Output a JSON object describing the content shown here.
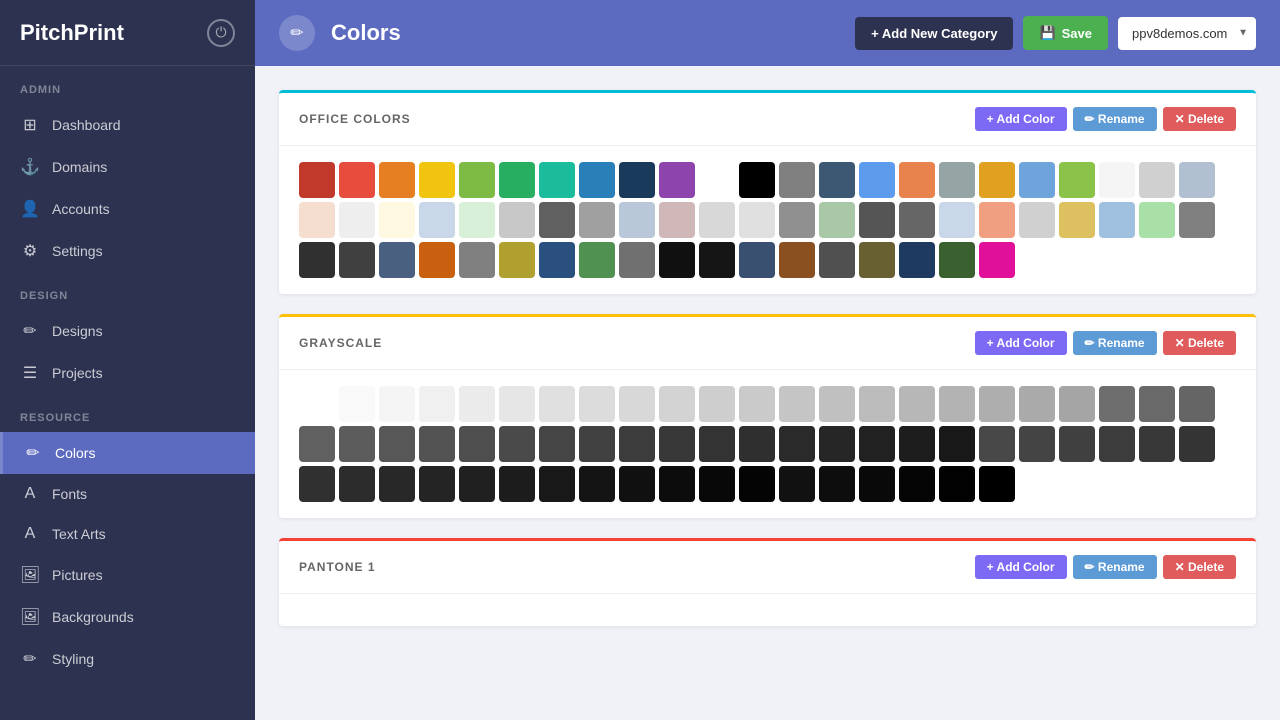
{
  "sidebar": {
    "logo": "PitchPrint",
    "sections": [
      {
        "label": "ADMIN",
        "items": [
          {
            "id": "dashboard",
            "label": "Dashboard",
            "icon": "⊞"
          },
          {
            "id": "domains",
            "label": "Domains",
            "icon": "⚓"
          },
          {
            "id": "accounts",
            "label": "Accounts",
            "icon": "👤"
          },
          {
            "id": "settings",
            "label": "Settings",
            "icon": "⚙"
          }
        ]
      },
      {
        "label": "DESIGN",
        "items": [
          {
            "id": "designs",
            "label": "Designs",
            "icon": "✏"
          },
          {
            "id": "projects",
            "label": "Projects",
            "icon": "☰"
          }
        ]
      },
      {
        "label": "RESOURCE",
        "items": [
          {
            "id": "colors",
            "label": "Colors",
            "icon": "✏",
            "active": true
          },
          {
            "id": "fonts",
            "label": "Fonts",
            "icon": "A"
          },
          {
            "id": "textarts",
            "label": "Text Arts",
            "icon": "A"
          },
          {
            "id": "pictures",
            "label": "Pictures",
            "icon": "🖼"
          },
          {
            "id": "backgrounds",
            "label": "Backgrounds",
            "icon": "🖼"
          },
          {
            "id": "styling",
            "label": "Styling",
            "icon": "✏"
          }
        ]
      }
    ]
  },
  "topbar": {
    "icon": "✏",
    "title": "Colors",
    "add_category_label": "+ Add New Category",
    "save_label": "Save",
    "domain": "ppv8demos.com"
  },
  "categories": [
    {
      "id": "office_colors",
      "title": "OFFICE COLORS",
      "border_color": "#00bcd4",
      "add_label": "+ Add Color",
      "rename_label": "✏ Rename",
      "delete_label": "✕ Delete",
      "colors": [
        "#c0392b",
        "#e74c3c",
        "#e67e22",
        "#f1c40f",
        "#7dbb44",
        "#27ae60",
        "#1abc9c",
        "#2980b9",
        "#1a3a5c",
        "#8e44ad",
        "#ffffff",
        "#000000",
        "#808080",
        "#3d5873",
        "#5d9cec",
        "#e8834e",
        "#95a5a6",
        "#e0a020",
        "#6fa3dc",
        "#8bc34a",
        "#f5f5f5",
        "#d0d0d0",
        "#b0c0d0",
        "#f5ddd0",
        "#eeeeee",
        "#fef9e0",
        "#c8d8e8",
        "#d8f0d8",
        "#c8c8c8",
        "#606060",
        "#a0a0a0",
        "#b8c8d8",
        "#d0b8b8",
        "#d8d8d8",
        "#e0e0e0",
        "#909090",
        "#a8c8a8",
        "#555555",
        "#666666",
        "#c8d8e8",
        "#f0a080",
        "#d0d0d0",
        "#ddc060",
        "#a0c0e0",
        "#a8e0a8",
        "#808080",
        "#303030",
        "#404040",
        "#4a6080",
        "#c86010",
        "#808080",
        "#b0a030",
        "#2a5080",
        "#509050",
        "#707070",
        "#101010",
        "#151515",
        "#3a5070",
        "#8a5020",
        "#505050",
        "#686030",
        "#1e3a60",
        "#3a6030",
        "#e0109a"
      ]
    },
    {
      "id": "grayscale",
      "title": "GRAYSCALE",
      "border_color": "#ffc107",
      "add_label": "+ Add Color",
      "rename_label": "✏ Rename",
      "delete_label": "✕ Delete",
      "colors": [
        "#ffffff",
        "#f9f9f9",
        "#f5f5f5",
        "#f0f0f0",
        "#ebebeb",
        "#e6e6e6",
        "#e0e0e0",
        "#dcdcdc",
        "#d8d8d8",
        "#d3d3d3",
        "#cecece",
        "#cacaca",
        "#c5c5c5",
        "#c0c0c0",
        "#bcbcbc",
        "#b7b7b7",
        "#b3b3b3",
        "#aeaeae",
        "#aaaaaa",
        "#a5a5a5",
        "#6e6e6e",
        "#696969",
        "#656565",
        "#606060",
        "#5c5c5c",
        "#575757",
        "#535353",
        "#4e4e4e",
        "#4a4a4a",
        "#454545",
        "#414141",
        "#3c3c3c",
        "#383838",
        "#333333",
        "#2f2f2f",
        "#2a2a2a",
        "#262626",
        "#212121",
        "#1d1d1d",
        "#181818",
        "#484848",
        "#444444",
        "#404040",
        "#3c3c3c",
        "#383838",
        "#343434",
        "#303030",
        "#2c2c2c",
        "#282828",
        "#242424",
        "#202020",
        "#1c1c1c",
        "#181818",
        "#141414",
        "#101010",
        "#0c0c0c",
        "#080808",
        "#040404",
        "#111111",
        "#0d0d0d",
        "#090909",
        "#050505",
        "#020202",
        "#000000"
      ]
    },
    {
      "id": "pantone_1",
      "title": "PANTONE 1",
      "border_color": "#f44336",
      "add_label": "+ Add Color",
      "rename_label": "✏ Rename",
      "delete_label": "✕ Delete",
      "colors": []
    }
  ]
}
